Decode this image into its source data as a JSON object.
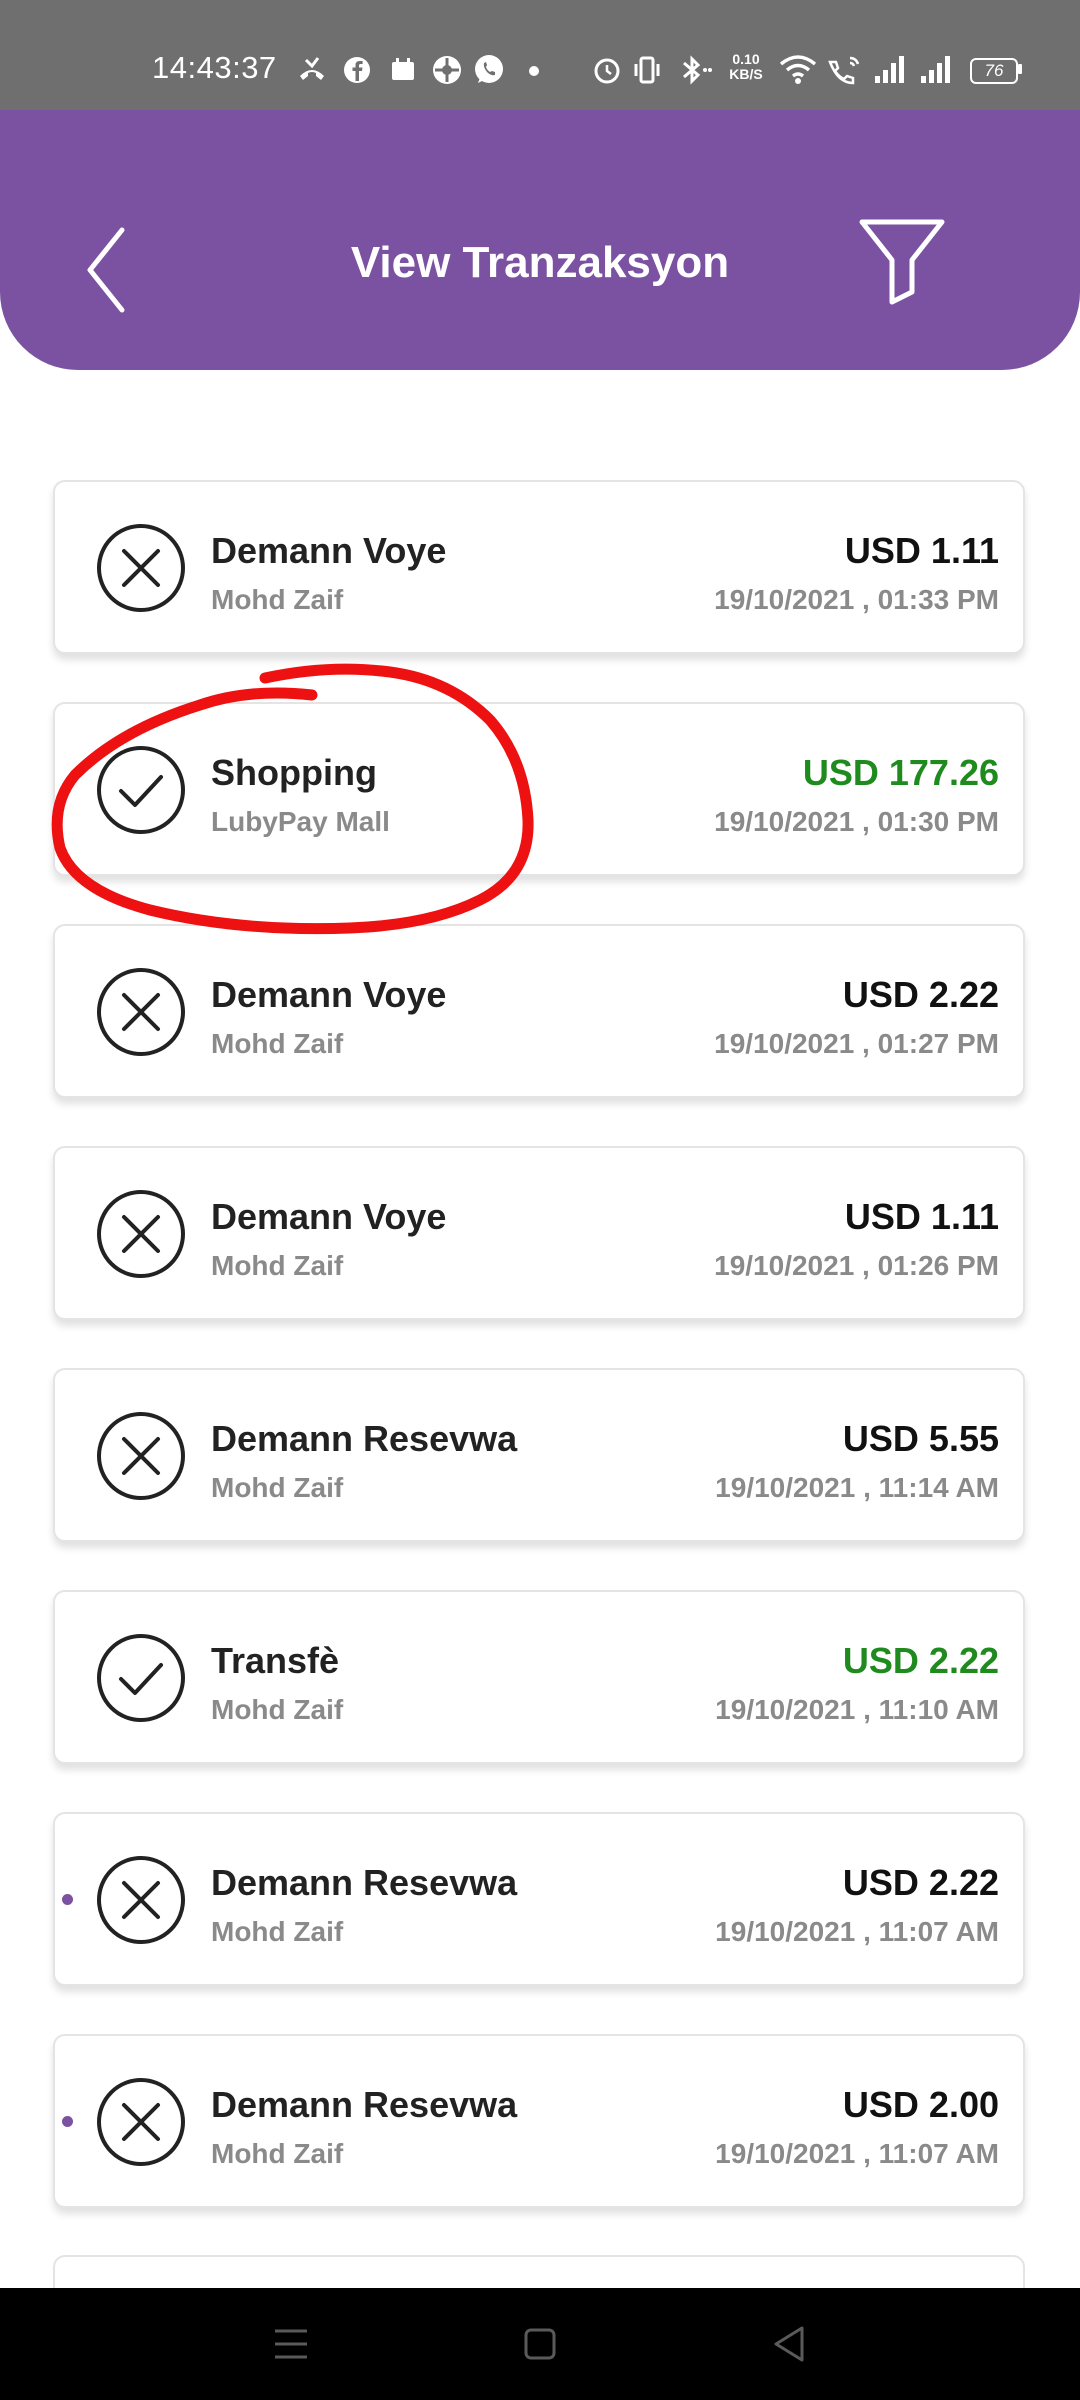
{
  "status_bar": {
    "time": "14:43:37",
    "net_speed_value": "0.10",
    "net_speed_unit": "KB/S",
    "battery": "76"
  },
  "header": {
    "title": "View Tranzaksyon",
    "background": "#7b52a1"
  },
  "transactions": [
    {
      "title": "Demann Voye",
      "subtitle": "Mohd Zaif",
      "amount": "USD 1.11",
      "date": "19/10/2021 , 01:33 PM",
      "status": "cancelled",
      "credit": false,
      "unread": false
    },
    {
      "title": "Shopping",
      "subtitle": "LubyPay Mall",
      "amount": "USD 177.26",
      "date": "19/10/2021 , 01:30 PM",
      "status": "completed",
      "credit": true,
      "unread": false
    },
    {
      "title": "Demann Voye",
      "subtitle": "Mohd Zaif",
      "amount": "USD 2.22",
      "date": "19/10/2021 , 01:27 PM",
      "status": "cancelled",
      "credit": false,
      "unread": false
    },
    {
      "title": "Demann Voye",
      "subtitle": "Mohd Zaif",
      "amount": "USD 1.11",
      "date": "19/10/2021 , 01:26 PM",
      "status": "cancelled",
      "credit": false,
      "unread": false
    },
    {
      "title": "Demann Resevwa",
      "subtitle": "Mohd Zaif",
      "amount": "USD 5.55",
      "date": "19/10/2021 , 11:14 AM",
      "status": "cancelled",
      "credit": false,
      "unread": false
    },
    {
      "title": "Transfè",
      "subtitle": "Mohd Zaif",
      "amount": "USD 2.22",
      "date": "19/10/2021 , 11:10 AM",
      "status": "completed",
      "credit": true,
      "unread": false
    },
    {
      "title": "Demann Resevwa",
      "subtitle": "Mohd Zaif",
      "amount": "USD 2.22",
      "date": "19/10/2021 , 11:07 AM",
      "status": "cancelled",
      "credit": false,
      "unread": true
    },
    {
      "title": "Demann Resevwa",
      "subtitle": "Mohd Zaif",
      "amount": "USD 2.00",
      "date": "19/10/2021 , 11:07 AM",
      "status": "cancelled",
      "credit": false,
      "unread": true
    }
  ],
  "colors": {
    "credit": "#1f8b1f",
    "annotation": "#ee1111"
  }
}
